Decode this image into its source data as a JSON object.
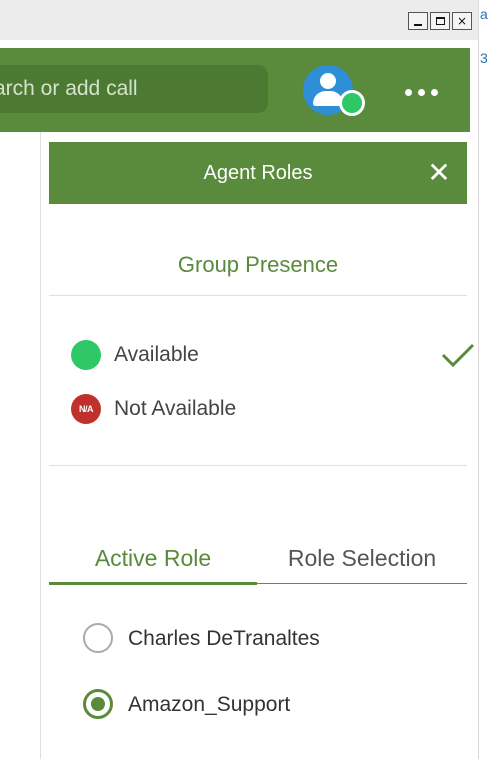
{
  "window": {
    "minimize_glyph": "",
    "maximize_glyph": "",
    "close_glyph": "×",
    "edge_text_top": "a",
    "edge_text_second": "3"
  },
  "header": {
    "search_placeholder": "arch or add call",
    "avatar_icon": "user-avatar-icon",
    "presence_color": "#2ec966",
    "more_icon": "more-horizontal-icon",
    "accent_color": "#5a8a3c"
  },
  "panel": {
    "title": "Agent Roles",
    "close_glyph": "✕",
    "group_presence_title": "Group Presence",
    "statuses": [
      {
        "label": "Available",
        "icon": "green-dot",
        "color": "#2ec966",
        "checked": true
      },
      {
        "label": "Not Available",
        "icon_text": "N/A",
        "color": "#c0312b",
        "checked": false
      }
    ],
    "tabs": [
      {
        "label": "Active Role",
        "active": true
      },
      {
        "label": "Role Selection",
        "active": false
      }
    ],
    "roles": [
      {
        "label": "Charles DeTranaltes",
        "selected": false
      },
      {
        "label": "Amazon_Support",
        "selected": true
      }
    ]
  }
}
